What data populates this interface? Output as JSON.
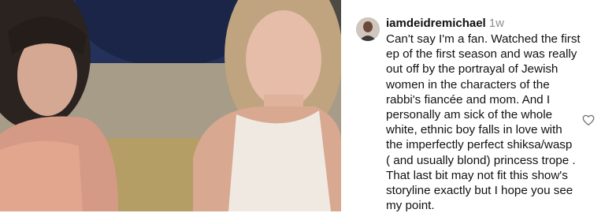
{
  "comment": {
    "username": "iamdeidremichael",
    "time_ago": "1w",
    "text": "Can't say I'm a fan. Watched the first\nep of the first season and was really\nout off by the portrayal of Jewish\nwomen in the characters of the\nrabbi's fiancée and mom. And I\npersonally am sick of the whole\nwhite, ethnic boy falls in love with\nthe imperfectly perfect shiksa/wasp\n( and usually blond) princess trope .\nThat last bit may not fit this show's\nstoryline exactly but I hope you see\nmy point."
  },
  "icons": {
    "like": "heart-outline-icon",
    "avatar": "profile-photo"
  },
  "colors": {
    "text": "#111111",
    "muted": "#8e8e8e",
    "background": "#ffffff"
  }
}
